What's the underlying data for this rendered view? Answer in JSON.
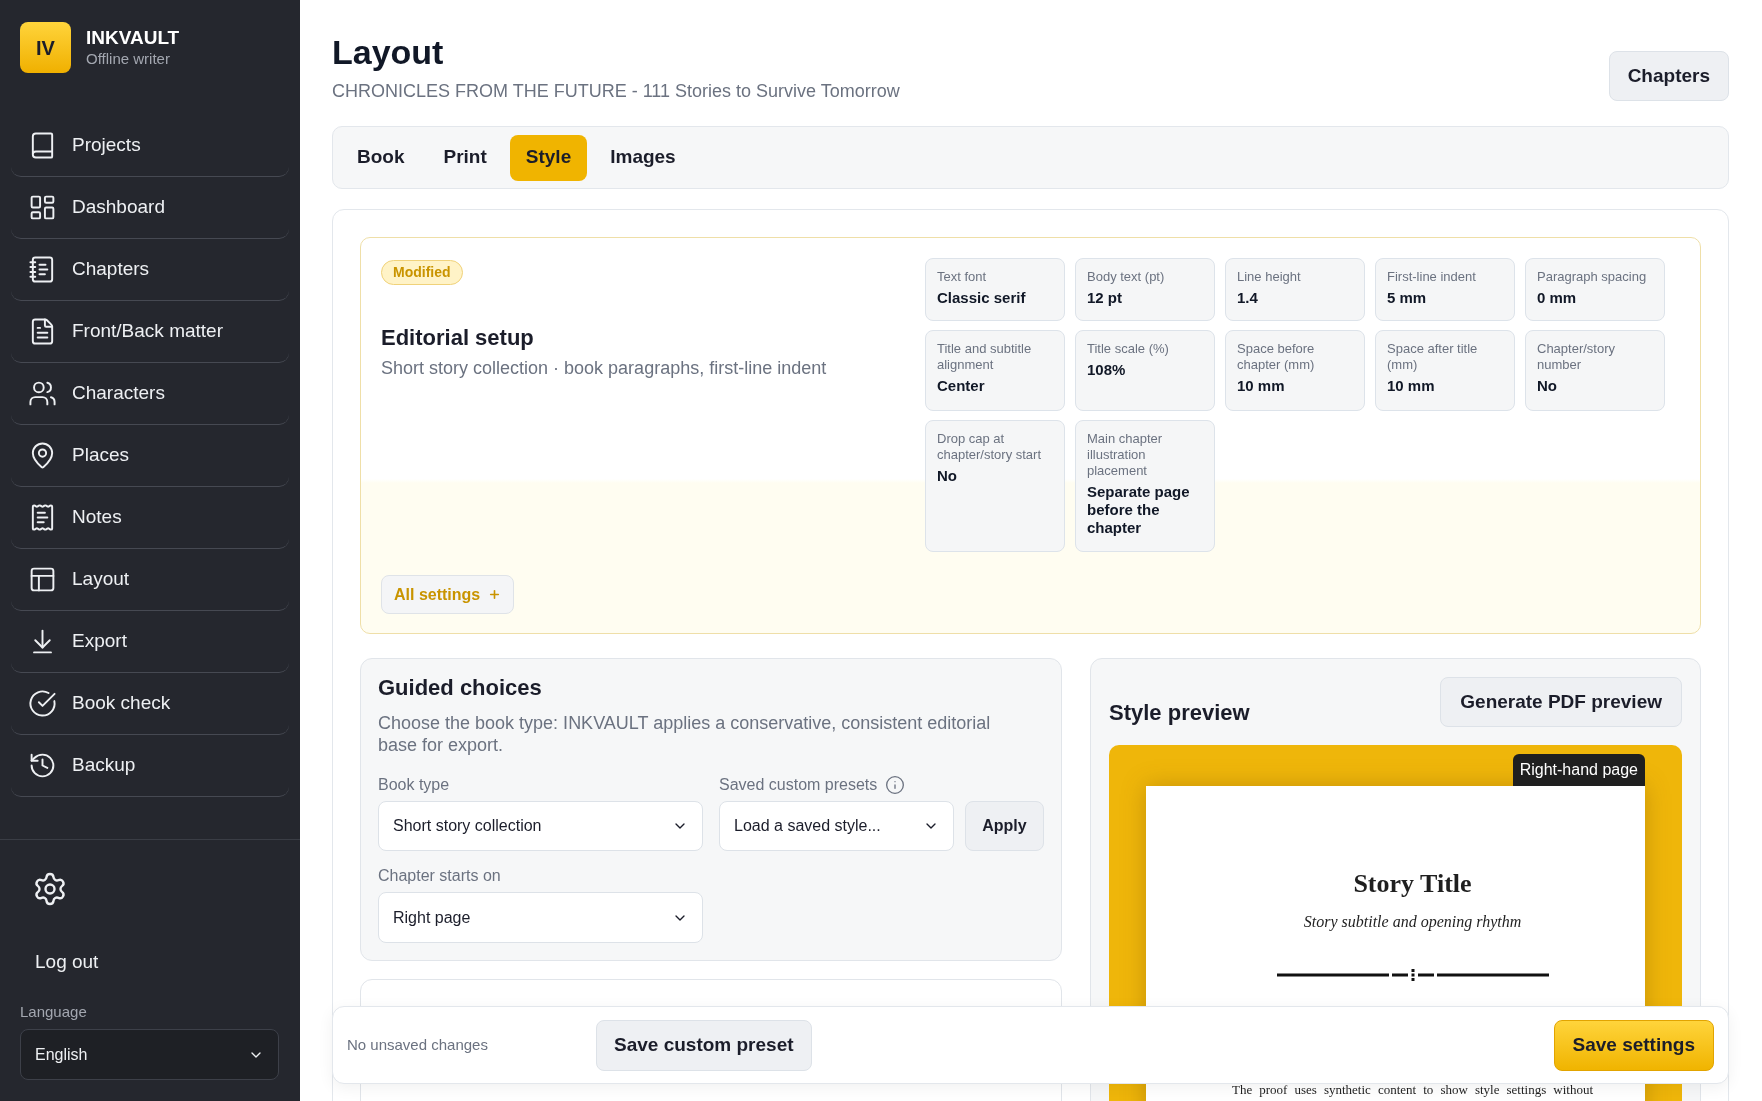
{
  "app": {
    "logo": "IV",
    "name": "INKVAULT",
    "tagline": "Offline writer"
  },
  "sidebar": {
    "items": [
      {
        "label": "Projects"
      },
      {
        "label": "Dashboard"
      },
      {
        "label": "Chapters"
      },
      {
        "label": "Front/Back matter"
      },
      {
        "label": "Characters"
      },
      {
        "label": "Places"
      },
      {
        "label": "Notes"
      },
      {
        "label": "Layout"
      },
      {
        "label": "Export"
      },
      {
        "label": "Book check"
      },
      {
        "label": "Backup"
      }
    ],
    "logout": "Log out",
    "language": {
      "label": "Language",
      "value": "English"
    }
  },
  "header": {
    "title": "Layout",
    "subtitle": "CHRONICLES FROM THE FUTURE - 111 Stories to Survive Tomorrow",
    "button": "Chapters"
  },
  "tabs": [
    {
      "label": "Book",
      "selected": false
    },
    {
      "label": "Print",
      "selected": false
    },
    {
      "label": "Style",
      "selected": true
    },
    {
      "label": "Images",
      "selected": false
    }
  ],
  "editorial": {
    "badge": "Modified",
    "title": "Editorial setup",
    "description": "Short story collection · book paragraphs, first-line indent",
    "settings": [
      {
        "label": "Text font",
        "value": "Classic serif"
      },
      {
        "label": "Body text (pt)",
        "value": "12 pt"
      },
      {
        "label": "Line height",
        "value": "1.4"
      },
      {
        "label": "First-line indent",
        "value": "5 mm"
      },
      {
        "label": "Paragraph spacing",
        "value": "0 mm"
      },
      {
        "label": "Title and subtitle alignment",
        "value": "Center"
      },
      {
        "label": "Title scale (%)",
        "value": "108%"
      },
      {
        "label": "Space before chapter (mm)",
        "value": "10 mm"
      },
      {
        "label": "Space after title (mm)",
        "value": "10 mm"
      },
      {
        "label": "Chapter/story number",
        "value": "No"
      },
      {
        "label": "Drop cap at chapter/story start",
        "value": "No"
      },
      {
        "label": "Main chapter illustration placement",
        "value": "Separate page before the chapter"
      }
    ],
    "button": "All settings"
  },
  "guided": {
    "title": "Guided choices",
    "description": "Choose the book type: INKVAULT applies a conservative, consistent editorial base for export.",
    "book_type": {
      "label": "Book type",
      "value": "Short story collection"
    },
    "presets": {
      "label": "Saved custom presets",
      "value": "Load a saved style...",
      "button": "Apply"
    },
    "chapter_start": {
      "label": "Chapter starts on",
      "value": "Right page"
    }
  },
  "preview": {
    "title": "Style preview",
    "button": "Generate PDF preview",
    "page_badge": "Right-hand page",
    "story_title": "Story Title",
    "story_subtitle": "Story subtitle and opening rhythm",
    "body": "The proof uses synthetic content to show style settings without"
  },
  "footer": {
    "status": "No unsaved changes",
    "secondary_button": "Save custom preset",
    "primary_button": "Save settings"
  }
}
